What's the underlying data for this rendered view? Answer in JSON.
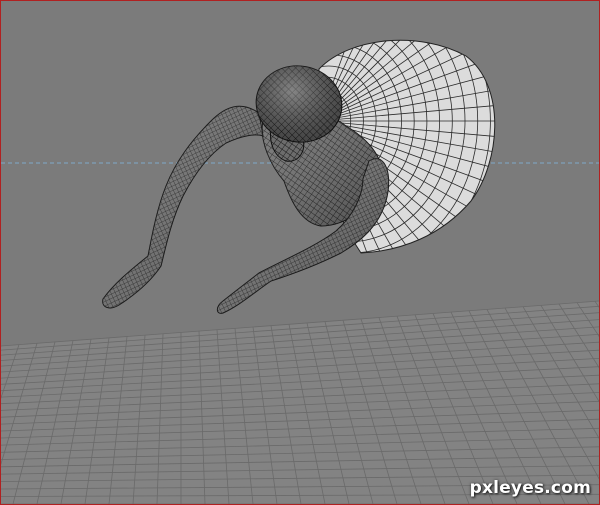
{
  "viewport": {
    "background_color": "#7b7b7b",
    "border_color": "#b02020",
    "horizon_line_color": "#7fa8c8"
  },
  "floor": {
    "color": "#838383",
    "grid_color": "#6a6a6a"
  },
  "mesh": {
    "fill_color": "#6e6e6e",
    "wire_color": "#1a1a1a",
    "skirt_color": "#d9d9d9"
  },
  "watermark": {
    "text": "pxleyes.com"
  }
}
